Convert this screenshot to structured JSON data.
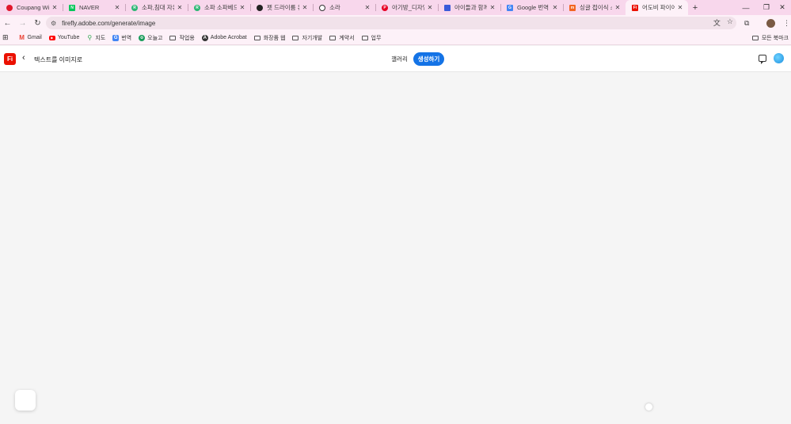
{
  "tabs": [
    {
      "title": "Coupang Wing",
      "favicon_color": "#e0162b",
      "favicon_glyph": ""
    },
    {
      "title": "NAVER",
      "favicon_color": "#03c75a",
      "favicon_glyph": "N"
    },
    {
      "title": "소파,침대 자유",
      "favicon_color": "#2bb673",
      "favicon_glyph": "R"
    },
    {
      "title": "소파 소파베드",
      "favicon_color": "#2bb673",
      "favicon_glyph": "R"
    },
    {
      "title": "펫 드라이룸 유",
      "favicon_color": "#222222",
      "favicon_glyph": ""
    },
    {
      "title": "소라",
      "favicon_color": "#333333",
      "favicon_glyph": ""
    },
    {
      "title": "아기방_디자인",
      "favicon_color": "#e60023",
      "favicon_glyph": "P"
    },
    {
      "title": "아이들과 함께",
      "favicon_color": "#3a5bd9",
      "favicon_glyph": ""
    },
    {
      "title": "Google 번역",
      "favicon_color": "#4285f4",
      "favicon_glyph": "G"
    },
    {
      "title": "싱글 접이식 소",
      "favicon_color": "#f26522",
      "favicon_glyph": "m"
    },
    {
      "title": "어도비 파이어",
      "favicon_color": "#eb1000",
      "favicon_glyph": "Fi"
    }
  ],
  "toolbar": {
    "url": "firefly.adobe.com/generate/image"
  },
  "bookmarks": [
    {
      "label": "Gmail",
      "icon": "gmail-icon",
      "color": "#ea4335"
    },
    {
      "label": "YouTube",
      "icon": "youtube-icon",
      "color": "#ff0000"
    },
    {
      "label": "지도",
      "icon": "maps-icon",
      "color": "#34a853"
    },
    {
      "label": "번역",
      "icon": "translate-icon",
      "color": "#4285f4"
    },
    {
      "label": "오늘고",
      "icon": "site-icon",
      "color": "#1a9c5b"
    },
    {
      "label": "작업용",
      "icon": "folder-icon",
      "color": ""
    },
    {
      "label": "Adobe Acrobat",
      "icon": "acrobat-icon",
      "color": "#333333"
    },
    {
      "label": "화장품 웹",
      "icon": "folder-icon",
      "color": ""
    },
    {
      "label": "자기개발",
      "icon": "folder-icon",
      "color": ""
    },
    {
      "label": "계약서",
      "icon": "folder-icon",
      "color": ""
    },
    {
      "label": "업무",
      "icon": "folder-icon",
      "color": ""
    }
  ],
  "bookmarks_all": "모든 북마크",
  "firefly": {
    "logo": "Fi",
    "title": "텍스트를 이미지로",
    "gallery": "갤러리",
    "generate": "생성하기",
    "accent": "#1473e6"
  }
}
